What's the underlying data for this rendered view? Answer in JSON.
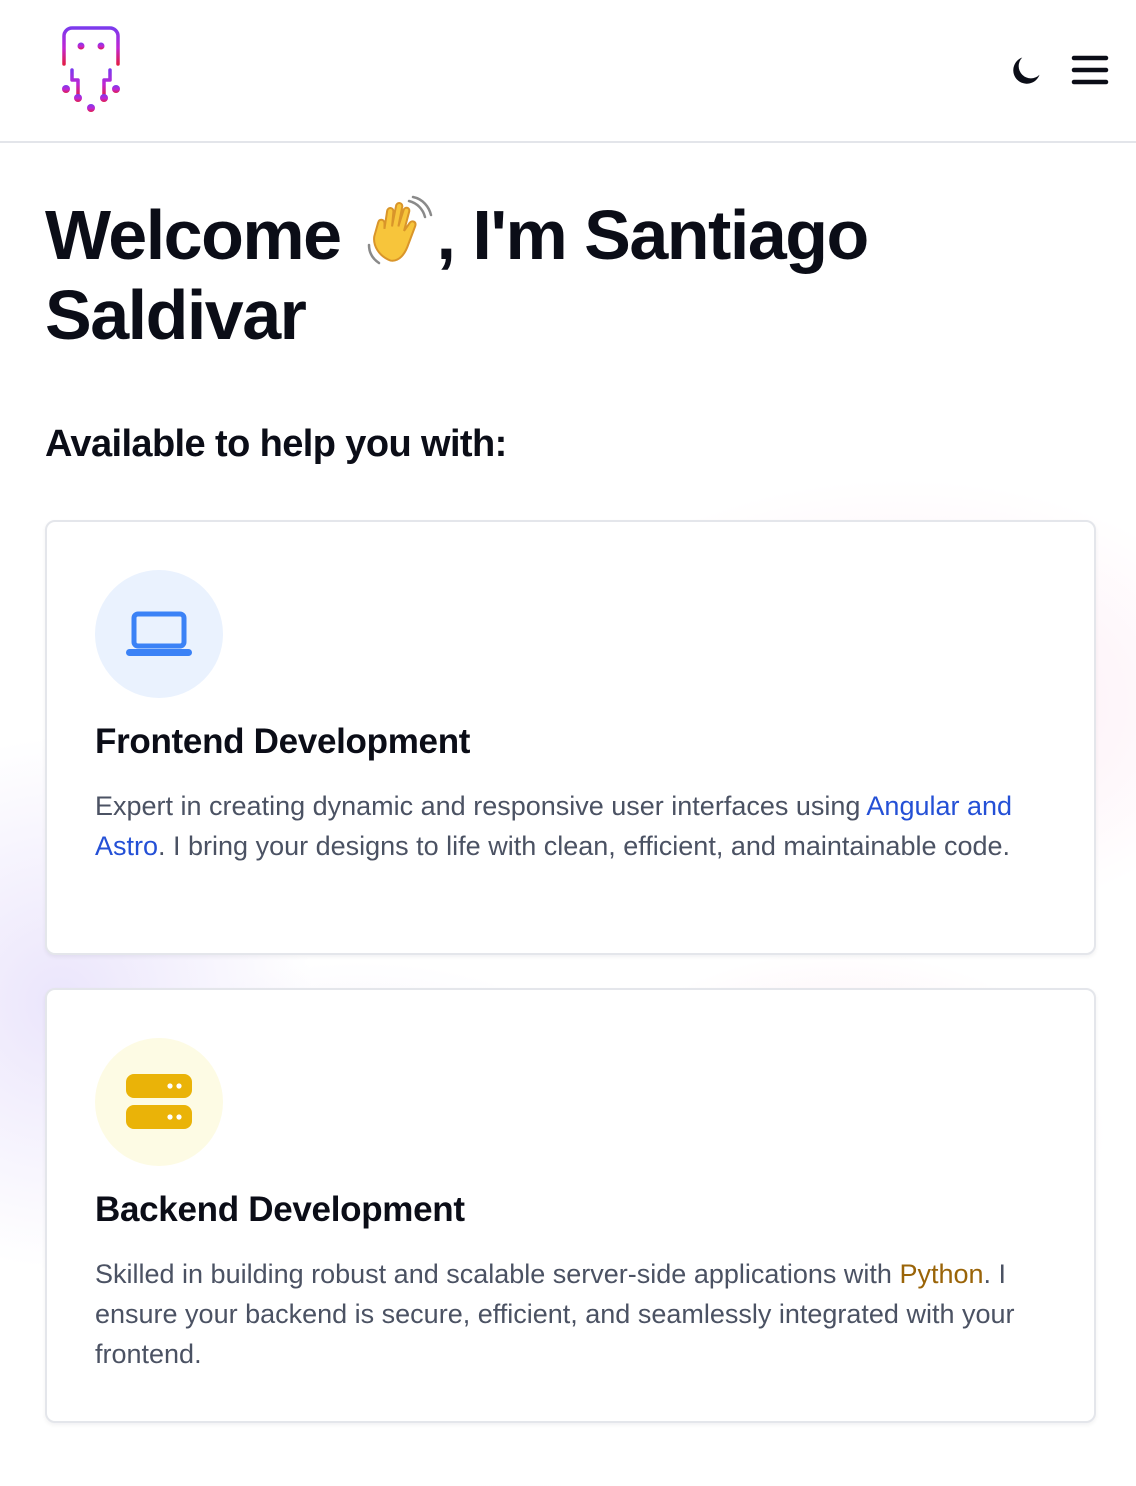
{
  "header": {
    "logo_name": "octopus-logo",
    "theme_toggle_icon": "moon-icon",
    "menu_icon": "hamburger-menu-icon"
  },
  "hero": {
    "title_part1": "Welcome ",
    "title_emoji": "waving-hand",
    "title_part2": ", I'm Santiago Saldivar"
  },
  "services": {
    "heading": "Available to help you with:",
    "items": [
      {
        "title": "Frontend Development",
        "icon": "laptop-icon",
        "accent": "#3b82f6",
        "desc_before": "Expert in creating dynamic and responsive user interfaces using ",
        "desc_highlight": "Angular and Astro",
        "desc_after": ". I bring your designs to life with clean, efficient, and maintainable code."
      },
      {
        "title": "Backend Development",
        "icon": "server-icon",
        "accent": "#eab308",
        "desc_before": "Skilled in building robust and scalable server-side applications with ",
        "desc_highlight": "Python",
        "desc_after": ". I ensure your backend is secure, efficient, and seamlessly integrated with your frontend."
      }
    ]
  },
  "colors": {
    "text": "#0b0d17",
    "body_text": "#4b5263",
    "link_blue": "#2450d6",
    "link_gold": "#9a6408"
  }
}
